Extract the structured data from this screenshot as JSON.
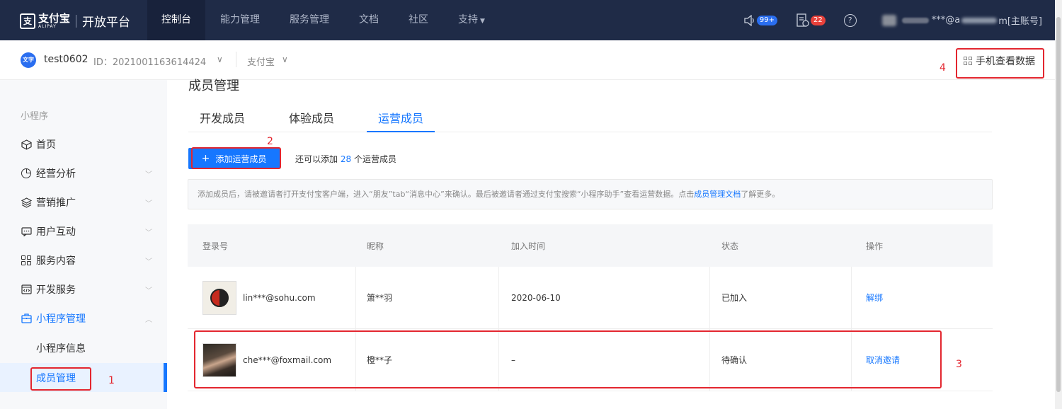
{
  "topbar": {
    "logo_cn": "支付宝",
    "logo_en": "ALIPAY",
    "platform": "开放平台",
    "nav": [
      {
        "label": "控制台",
        "active": true
      },
      {
        "label": "能力管理",
        "active": false
      },
      {
        "label": "服务管理",
        "active": false
      },
      {
        "label": "文档",
        "active": false
      },
      {
        "label": "社区",
        "active": false
      },
      {
        "label": "支持",
        "active": false,
        "dropdown": true
      }
    ],
    "notice_badge": "99+",
    "task_badge": "22",
    "help_symbol": "?",
    "account_fragment_1": "***@a",
    "account_fragment_2": "m[主账号]"
  },
  "app_header": {
    "avatar_text": "文字",
    "app_name": "test0602",
    "app_id": "ID：2021001163614424",
    "org": "支付宝",
    "mobile_view": "手机查看数据"
  },
  "sidebar": {
    "section": "小程序",
    "items": [
      {
        "label": "首页",
        "icon": "home-cube-icon"
      },
      {
        "label": "经营分析",
        "icon": "pie-chart-icon"
      },
      {
        "label": "营销推广",
        "icon": "layers-icon"
      },
      {
        "label": "用户互动",
        "icon": "message-icon"
      },
      {
        "label": "服务内容",
        "icon": "grid-icon"
      },
      {
        "label": "开发服务",
        "icon": "code-icon"
      },
      {
        "label": "小程序管理",
        "icon": "briefcase-icon"
      }
    ],
    "sub_items": [
      "小程序信息",
      "成员管理"
    ]
  },
  "main": {
    "title": "成员管理",
    "tabs": [
      "开发成员",
      "体验成员",
      "运营成员"
    ],
    "active_tab": "运营成员",
    "add_button": "添加运营成员",
    "quota_prefix": "还可以添加",
    "quota_count": "28",
    "quota_suffix": "个运营成员",
    "notice_text": "添加成员后，请被邀请者打开支付宝客户端，进入“朋友”tab“消息中心”来确认。最后被邀请者通过支付宝搜索“小程序助手”查看运营数据。点击",
    "notice_link": "成员管理文档",
    "notice_tail": "了解更多。"
  },
  "table": {
    "headers": [
      "登录号",
      "昵称",
      "加入时间",
      "状态",
      "操作"
    ],
    "rows": [
      {
        "login": "lin***@sohu.com",
        "nickname": "箫**羽",
        "joined": "2020-06-10",
        "status": "已加入",
        "action": "解绑",
        "avatar": "taiji-avatar"
      },
      {
        "login": "che***@foxmail.com",
        "nickname": "橙**子",
        "joined": "–",
        "status": "待确认",
        "action": "取消邀请",
        "avatar": "portrait-avatar"
      }
    ]
  },
  "annotations": [
    "1",
    "2",
    "3",
    "4"
  ],
  "colors": {
    "topbar": "#1f2b47",
    "accent": "#1677ff",
    "annotation": "#e3262f"
  }
}
